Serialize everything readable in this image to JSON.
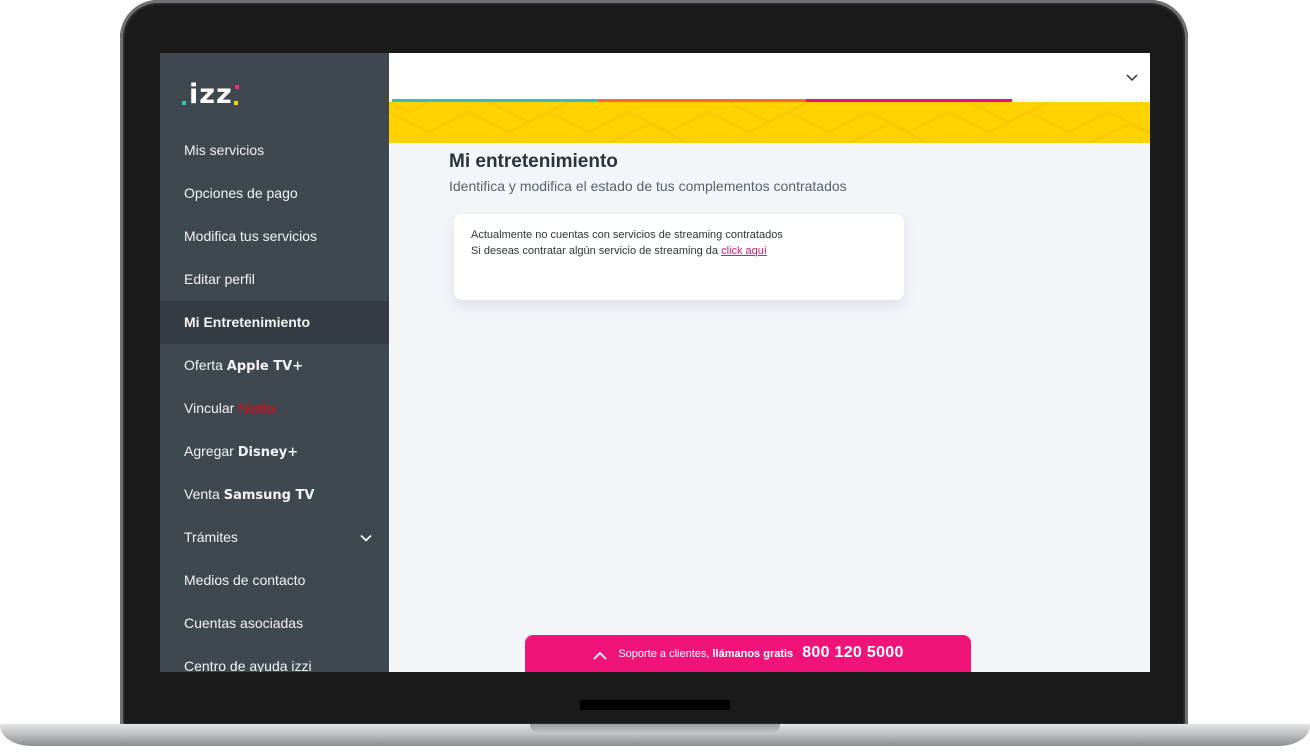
{
  "sidebar": {
    "logo_text": "izz",
    "items": [
      {
        "label": "Mis servicios"
      },
      {
        "label": "Opciones de pago"
      },
      {
        "label": "Modifica tus servicios"
      },
      {
        "label": "Editar perfil"
      },
      {
        "label": "Mi Entretenimiento",
        "active": true
      },
      {
        "label": "Oferta ",
        "brand": "Apple TV+"
      },
      {
        "label": "Vincular ",
        "brand": "Netflix"
      },
      {
        "label": "Agregar ",
        "brand": "Disney+"
      },
      {
        "label": "Venta ",
        "brand": "Samsung TV"
      },
      {
        "label": "Trámites",
        "icon": "chevron-down-icon"
      },
      {
        "label": "Medios de contacto"
      },
      {
        "label": "Cuentas asociadas"
      },
      {
        "label": "Centro de ayuda izzi"
      }
    ]
  },
  "header": {
    "menu_icon": "chevron-down-icon",
    "stripe_colors": [
      "#2ec4b6",
      "#ff6a2b",
      "#e5127d"
    ]
  },
  "main": {
    "title": "Mi entretenimiento",
    "subtitle": "Identifica y modifica el estado de tus complementos contratados",
    "card": {
      "line1": "Actualmente no cuentas con servicios de streaming contratados",
      "line2_prefix": "Si deseas contratar algún servicio de streaming da ",
      "link": "click aquí"
    }
  },
  "support": {
    "icon": "chevron-up-icon",
    "text_prefix": "Soporte a clientes, ",
    "text_bold": "llámanos gratis",
    "phone": "800 120 5000"
  },
  "colors": {
    "sidebar_bg": "#3f474f",
    "accent_yellow": "#ffd200",
    "accent_pink": "#f0147a",
    "netflix_red": "#e50914"
  }
}
